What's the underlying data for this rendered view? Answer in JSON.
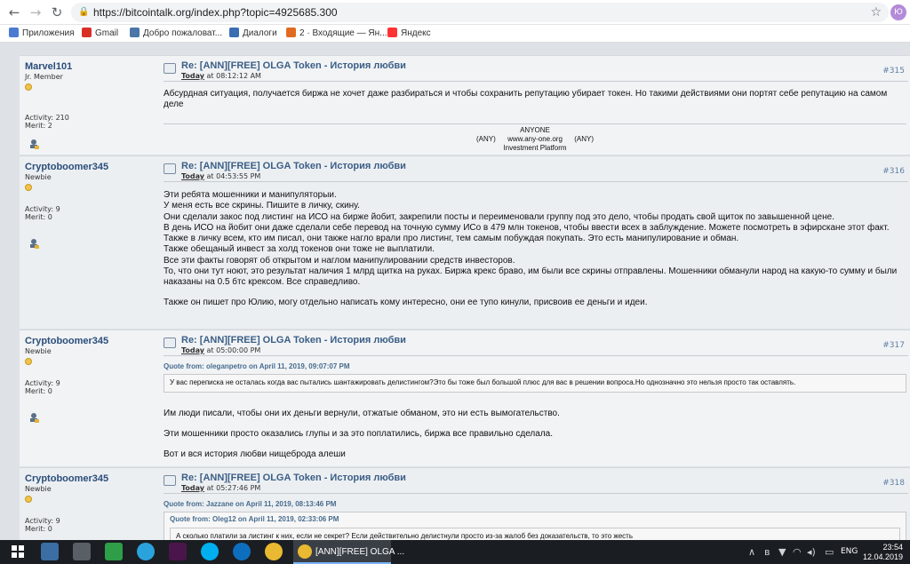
{
  "browser": {
    "url": "https://bitcointalk.org/index.php?topic=4925685.300",
    "user_initial": "Ю",
    "bookmarks": [
      {
        "label": "Приложения",
        "color": "#4a7bd0"
      },
      {
        "label": "Gmail",
        "color": "#d93025"
      },
      {
        "label": "Добро пожаловат...",
        "color": "#4a76a8"
      },
      {
        "label": "Диалоги",
        "color": "#3b6db3"
      },
      {
        "label": "2 · Входящие — Ян...",
        "color": "#e06b20"
      },
      {
        "label": "Яндекс",
        "color": "#f33"
      }
    ]
  },
  "posts": [
    {
      "username": "Marvel101",
      "rank": "Jr. Member",
      "activity": "Activity: 210",
      "merit": "Merit: 2",
      "title": "Re: [ANN][FREE] OLGA Token - История любви",
      "time_prefix": "Today",
      "time": "at 08:12:12 AM",
      "number": "#315",
      "lines": [
        "Абсурдная ситуация, получается биржа не хочет даже разбираться и чтобы сохранить репутацию убирает токен. Но такими действиями они портят себе репутацию на самом деле"
      ],
      "signature": [
        "ANYONE",
        "(ANY)      www.any-one.org      (ANY)",
        "Investment Platform"
      ]
    },
    {
      "username": "Cryptoboomer345",
      "rank": "Newbie",
      "activity": "Activity: 9",
      "merit": "Merit: 0",
      "title": "Re: [ANN][FREE] OLGA Token - История любви",
      "time_prefix": "Today",
      "time": "at 04:53:55 PM",
      "number": "#316",
      "lines": [
        "Эти ребята мошенники и манипуляторыи.",
        "У меня есть все скрины. Пишите в личку, скину.",
        "Они сделали закос под листинг на ИСО на бирже йобит, закрепили посты и переименовали группу под это дело, чтобы продать свой щиток по завышенной цене.",
        "В день ИСО на йобит они даже сделали себе перевод на точную сумму ИСо в 479 млн токенов, чтобы ввести всех в заблуждение. Можете посмотреть в эфирскане этот факт.",
        "Также в личку всем, кто им писал, они также нагло врали про листинг, тем самым побуждая покупать. Это есть манипулирование и обман.",
        "Также обещаный инвест за холд токенов они тоже не выплатили.",
        "Все эти факты говорят об открытом и наглом манипулировании средств инвесторов.",
        "То, что они тут ноют, это результат наличия 1 млрд щитка на руках. Биржа крекс браво, им были все скрины отправлены. Мошенники обманули народ на какую-то сумму и были наказаны на 0.5 бтс крексом. Все справедливо.",
        "",
        "Также он пишет про Юлию, могу отдельно написать кому интересно, они ее тупо кинули, присвоив ее деньги и идеи."
      ]
    },
    {
      "username": "Cryptoboomer345",
      "rank": "Newbie",
      "activity": "Activity: 9",
      "merit": "Merit: 0",
      "title": "Re: [ANN][FREE] OLGA Token - История любви",
      "time_prefix": "Today",
      "time": "at 05:00:00 PM",
      "number": "#317",
      "quote_header": "Quote from: oleganpetro on April 11, 2019, 09:07:07 PM",
      "quote_text": "У вас переписка не осталась когда вас пытались шантажировать делистингом?Это бы тоже был большой плюс для вас в решении вопроса.Но однозначно это нельзя просто так оставлять.",
      "paragraphs": [
        "Им люди писали, чтобы они их деньги вернули, отжатые обманом, это ни есть вымогательство.",
        "Эти мошенники просто оказались глупы и за это поплатились, биржа все правильно сделала.",
        "Вот и вся история любви нищеброда алеши"
      ]
    },
    {
      "username": "Cryptoboomer345",
      "rank": "Newbie",
      "activity": "Activity: 9",
      "merit": "Merit: 0",
      "title": "Re: [ANN][FREE] OLGA Token - История любви",
      "time_prefix": "Today",
      "time": "at 05:27:46 PM",
      "number": "#318",
      "quote_header": "Quote from: Jazzane on April 11, 2019, 08:13:46 PM",
      "inner_quote_header": "Quote from: Oleg12 on April 11, 2019, 02:33:06 PM",
      "inner_quote_text": "А сколько платили за листинг к них, если не секрет? Если действительно делистнули просто из-за жалоб без доказательств, то это жесть"
    }
  ],
  "taskbar": {
    "active_window": "[ANN][FREE] OLGA ...",
    "lang": "ENG",
    "time": "23:54",
    "date": "12.04.2019"
  }
}
